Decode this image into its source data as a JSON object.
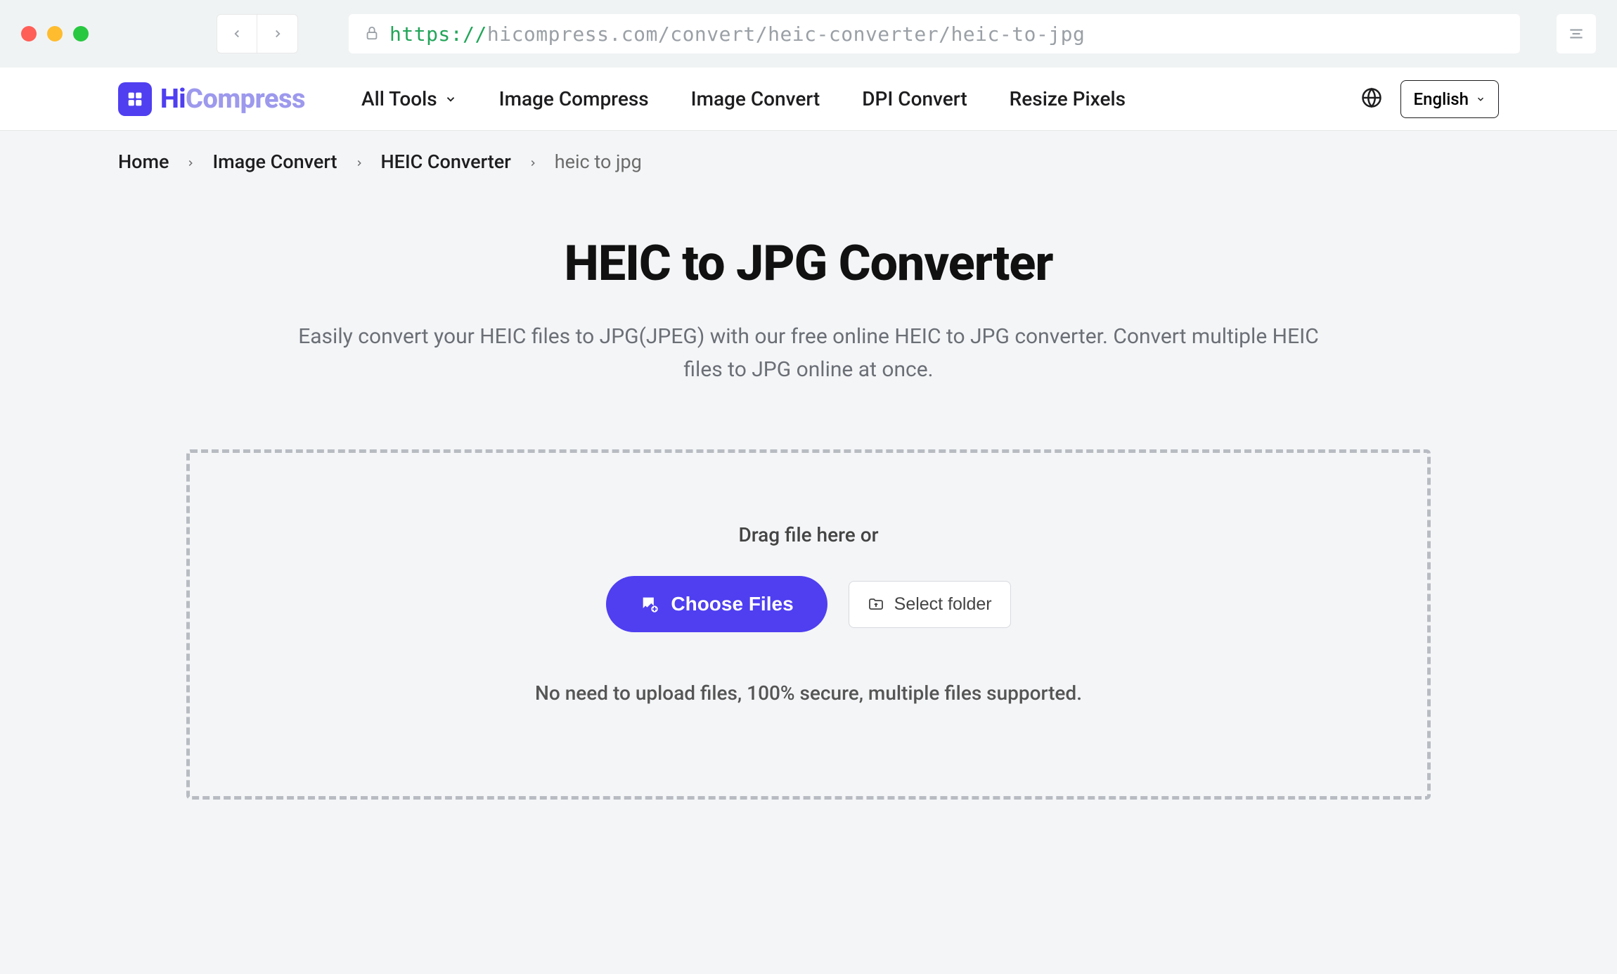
{
  "browser": {
    "url_protocol": "https://",
    "url_rest": "hicompress.com/convert/heic-converter/heic-to-jpg"
  },
  "header": {
    "logo_hi": "Hi",
    "logo_compress": "Compress",
    "nav": {
      "all_tools": "All Tools",
      "image_compress": "Image Compress",
      "image_convert": "Image Convert",
      "dpi_convert": "DPI Convert",
      "resize_pixels": "Resize Pixels"
    },
    "language": "English"
  },
  "breadcrumb": {
    "home": "Home",
    "image_convert": "Image Convert",
    "heic_converter": "HEIC Converter",
    "current": "heic to jpg"
  },
  "main": {
    "title": "HEIC to JPG Converter",
    "subtitle": "Easily convert your HEIC files to JPG(JPEG) with our free online HEIC to JPG converter. Convert multiple HEIC files to JPG online at once."
  },
  "dropzone": {
    "drag_label": "Drag file here or",
    "choose_files": "Choose Files",
    "select_folder": "Select folder",
    "note": "No need to upload files, 100% secure, multiple files supported."
  }
}
